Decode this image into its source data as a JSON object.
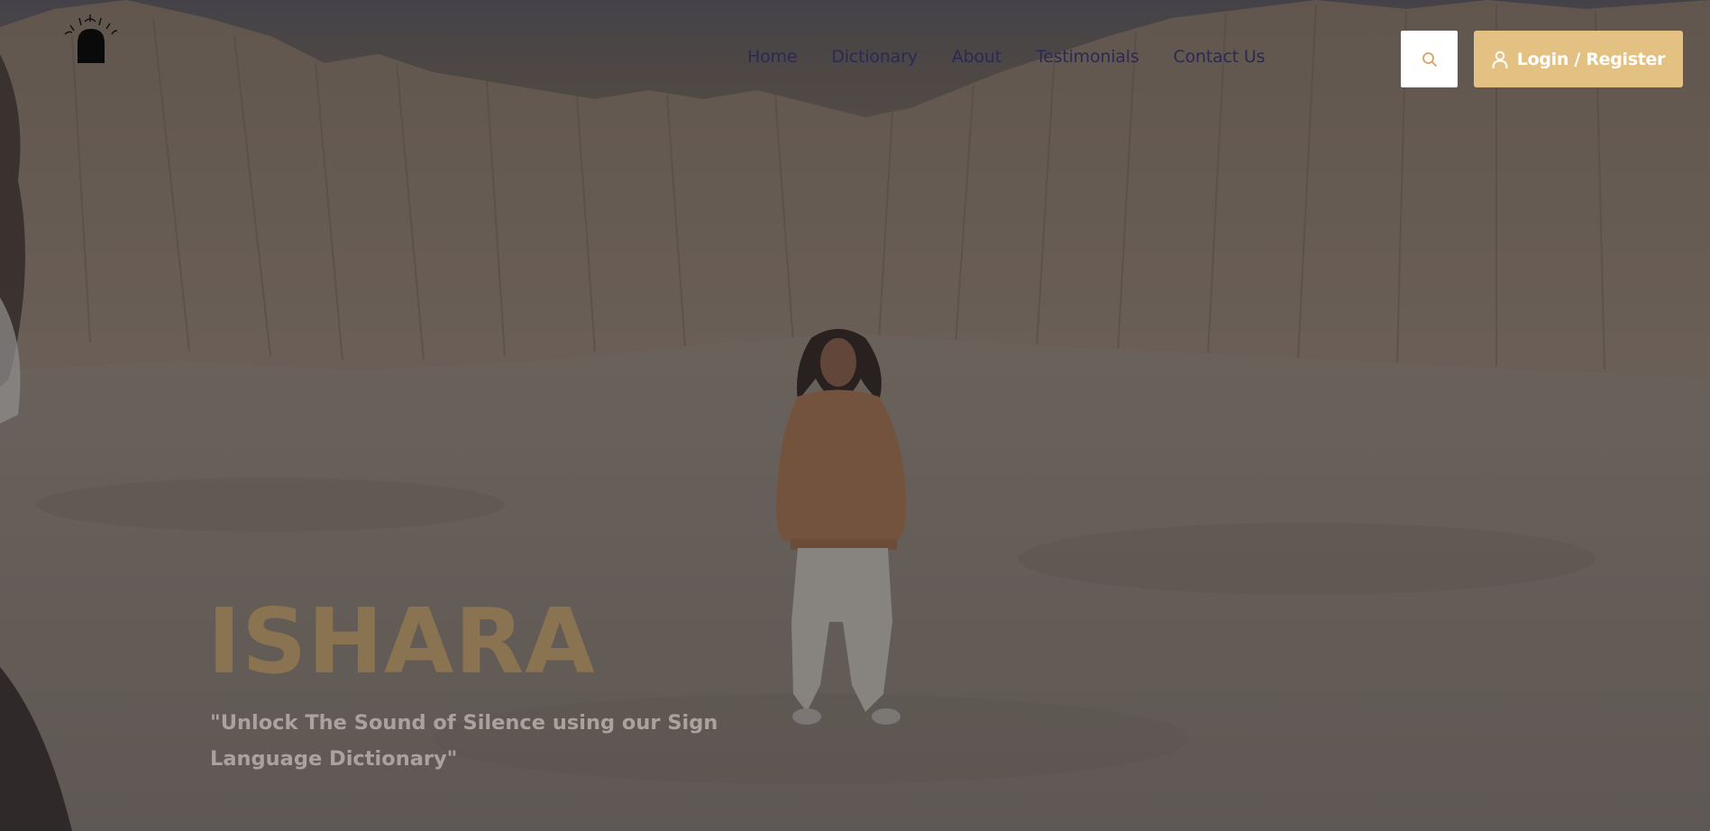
{
  "header": {
    "logo_icon": "ishara-logo-icon",
    "nav": [
      {
        "label": "Home"
      },
      {
        "label": "Dictionary"
      },
      {
        "label": "About"
      },
      {
        "label": "Testimonials"
      },
      {
        "label": "Contact Us"
      }
    ],
    "search_icon": "search-icon",
    "login_label": "Login / Register",
    "login_icon": "user-icon"
  },
  "hero": {
    "title": "ISHARA",
    "subtitle": "\"Unlock The Sound of Silence using our Sign Language Dictionary\""
  },
  "colors": {
    "nav_text": "#2a2954",
    "accent": "#e3c182",
    "title": "#8a7350",
    "subtitle": "#aaa39d"
  }
}
